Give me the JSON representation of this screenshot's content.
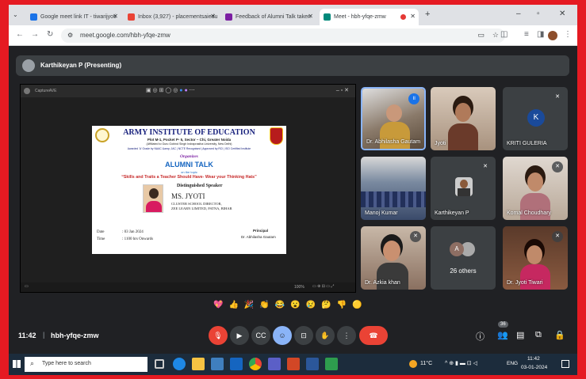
{
  "browser": {
    "tabs": [
      {
        "label": "Google meet link IT - tiwarijyoti",
        "color": "#1a73e8"
      },
      {
        "label": "Inbox (3,927) - placementsaiedu",
        "color": "#ea4335"
      },
      {
        "label": "Feedback of Alumni Talk taken",
        "color": "#7b1fa2"
      },
      {
        "label": "Meet - hbh-yfqe-zmw",
        "color": "#00897b"
      }
    ],
    "url": "meet.google.com/hbh-yfqe-zmw"
  },
  "presenting": {
    "label": "Karthikeyan P (Presenting)"
  },
  "share": {
    "app_label": "CaptureAVE",
    "zoom": "100%",
    "poster": {
      "title": "ARMY INSTITUTE OF EDUCATION",
      "address": "Plot M-1, Pocket P- 5, Sector – Chi, Greater Noida",
      "affiliation": "(Affiliated to Guru Gobind Singh Indraprastha University, New Delhi)",
      "accreditation": "Awarded 'A' Grade by NAAC &amp; JAC | NCTE Recognised | Approved by RCI | ISO Certified Institute",
      "organizes": "Organizes",
      "event": "ALUMNI TALK",
      "on_topic": "on the topic",
      "topic": "“Skills and Traits a Teacher Should Have- Wear your Thinking Hats”",
      "speaker_heading": "Distinguished Speaker",
      "speaker_name": "MS. JYOTI",
      "speaker_role": "CLUSTER SCHOOL DIRECTOR,",
      "speaker_org": "ZEE LEARN LIMITED, PATNA, BIHAR",
      "date_label": "Date",
      "date_value": ": 03 Jan 2024",
      "time_label": "Time",
      "time_value": ": 1100 hrs Onwards",
      "principal_title": "Principal",
      "principal_name": "Dr. Abhilasha Gautam"
    }
  },
  "participants": [
    {
      "name": "Dr. Abhilasha Gautam",
      "bg": "#8a7a6a"
    },
    {
      "name": "Jyoti",
      "bg": "#b09a8a"
    },
    {
      "name": "KRITI GULERIA",
      "bg": "#3c4043",
      "initial": "K",
      "avatar": "#1a4a9a"
    },
    {
      "name": "Manoj Kumar",
      "bg": "#4a5a7a"
    },
    {
      "name": "Karthikeyan P",
      "bg": "#3c4043"
    },
    {
      "name": "Komal Choudhary",
      "bg": "#9a8070"
    },
    {
      "name": "Dr. Azkia khan",
      "bg": "#a08878"
    },
    {
      "name": "26 others",
      "bg": "#3c4043",
      "initial": "A"
    },
    {
      "name": "Dr. Jyoti Tiwari",
      "bg": "#6a4a3a"
    }
  ],
  "reactions": [
    "💖",
    "👍",
    "🎉",
    "👏",
    "😂",
    "😮",
    "😢",
    "🤔",
    "👎",
    "🟡"
  ],
  "meeting": {
    "time": "11:42",
    "code": "hbh-yfqe-zmw",
    "participant_count": "36"
  },
  "taskbar": {
    "search_placeholder": "Type here to search",
    "weather": "11°C",
    "lang": "ENG",
    "time": "11:42",
    "date": "03-01-2024"
  }
}
